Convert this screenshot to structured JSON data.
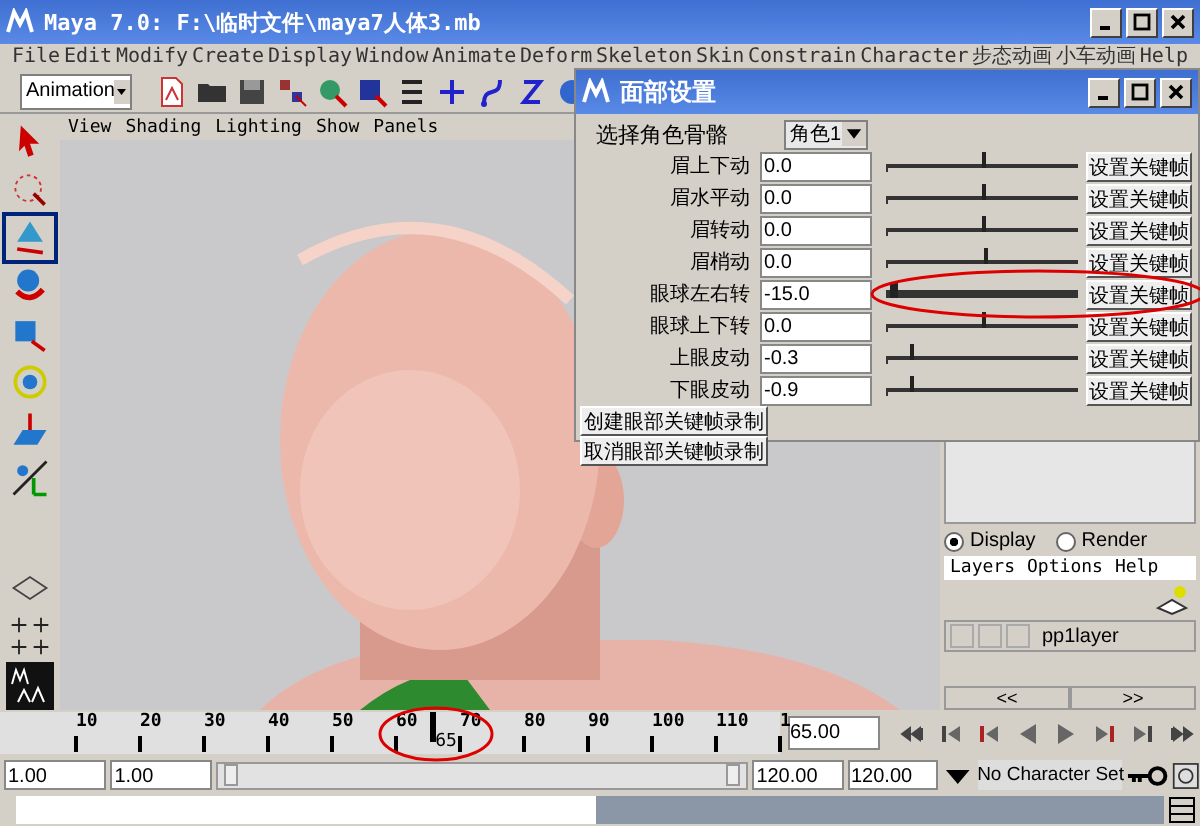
{
  "window": {
    "title": "Maya 7.0: F:\\临时文件\\maya7人体3.mb"
  },
  "menu_bar": [
    "File",
    "Edit",
    "Modify",
    "Create",
    "Display",
    "Window",
    "Animate",
    "Deform",
    "Skeleton",
    "Skin",
    "Constrain",
    "Character",
    "步态动画",
    "小车动画",
    "Help"
  ],
  "menu_set": {
    "value": "Animation"
  },
  "viewport": {
    "menu": [
      "View",
      "Shading",
      "Lighting",
      "Show",
      "Panels"
    ],
    "kind": "picture"
  },
  "dialog": {
    "title": "面部设置",
    "selector_label": "选择角色骨骼",
    "selector_value": "角色1",
    "rows": [
      {
        "label": "眉上下动",
        "value": "0.0",
        "level": 0.5,
        "button": "设置关键帧"
      },
      {
        "label": "眉水平动",
        "value": "0.0",
        "level": 0.5,
        "button": "设置关键帧"
      },
      {
        "label": "眉转动",
        "value": "0.0",
        "level": 0.5,
        "button": "设置关键帧"
      },
      {
        "label": "眉梢动",
        "value": "0.0",
        "level": 0.51,
        "button": "设置关键帧"
      },
      {
        "label": "眼球左右转",
        "value": "-15.0",
        "level": 0.02,
        "button": "设置关键帧"
      },
      {
        "label": "眼球上下转",
        "value": "0.0",
        "level": 0.5,
        "button": "设置关键帧"
      },
      {
        "label": "上眼皮动",
        "value": "-0.3",
        "level": 0.12,
        "button": "设置关键帧"
      },
      {
        "label": "下眼皮动",
        "value": "-0.9",
        "level": 0.12,
        "button": "设置关键帧"
      }
    ],
    "buttons": [
      "创建眼部关键帧录制",
      "取消眼部关键帧录制"
    ]
  },
  "layer_editor": {
    "modes": [
      {
        "label": "Display",
        "selected": true
      },
      {
        "label": "Render",
        "selected": false
      }
    ],
    "menu": [
      "Layers",
      "Options",
      "Help"
    ],
    "layers": [
      {
        "name": "pp1layer"
      }
    ],
    "pager": [
      "<<",
      ">>"
    ]
  },
  "time_slider": {
    "ticks": [
      "10",
      "20",
      "30",
      "40",
      "50",
      "60",
      "70",
      "80",
      "90",
      "100",
      "110",
      "1"
    ],
    "current_frame": "65",
    "level": 0.538,
    "current_time": "65.00"
  },
  "range_slider": {
    "level": 1,
    "start_time": "1.00",
    "playback_start": "1.00",
    "playback_end": "120.00",
    "end_time": "120.00",
    "character_set": "No Character Set"
  }
}
